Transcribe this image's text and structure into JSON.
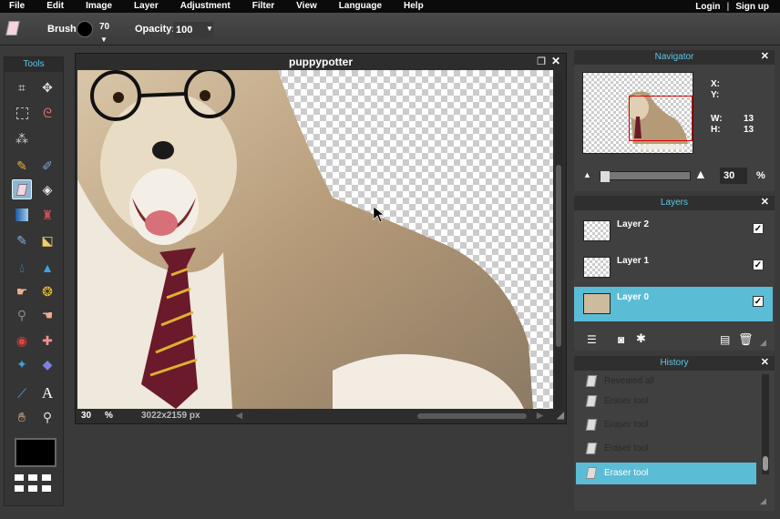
{
  "menu": {
    "items": [
      "File",
      "Edit",
      "Image",
      "Layer",
      "Adjustment",
      "Filter",
      "View",
      "Language",
      "Help"
    ],
    "login": "Login",
    "signup": "Sign up",
    "separator": "|"
  },
  "options": {
    "brush_label": "Brush:",
    "brush_size": "70",
    "opacity_label": "Opacity:",
    "opacity_value": "100"
  },
  "tools": {
    "title": "Tools",
    "active": "eraser"
  },
  "canvas": {
    "title": "puppypotter",
    "zoom": "30",
    "zoom_unit": "%",
    "dimensions": "3022x2159 px"
  },
  "navigator": {
    "title": "Navigator",
    "x_label": "X:",
    "y_label": "Y:",
    "w_label": "W:",
    "h_label": "H:",
    "w_value": "13",
    "h_value": "13",
    "zoom": "30",
    "zoom_unit": "%"
  },
  "layers": {
    "title": "Layers",
    "items": [
      {
        "name": "Layer 2",
        "visible": true,
        "selected": false
      },
      {
        "name": "Layer 1",
        "visible": true,
        "selected": false
      },
      {
        "name": "Layer 0",
        "visible": true,
        "selected": true
      }
    ]
  },
  "history": {
    "title": "History",
    "items": [
      {
        "label": "Revealed all",
        "selected": false
      },
      {
        "label": "Eraser tool",
        "selected": false
      },
      {
        "label": "Eraser tool",
        "selected": false
      },
      {
        "label": "Eraser tool",
        "selected": false
      },
      {
        "label": "Eraser tool",
        "selected": true
      }
    ]
  },
  "colors": {
    "accent": "#5bbcd6",
    "title_accent": "#5bc8e8",
    "foreground": "#000000",
    "nav_rect": "#dd0000"
  }
}
